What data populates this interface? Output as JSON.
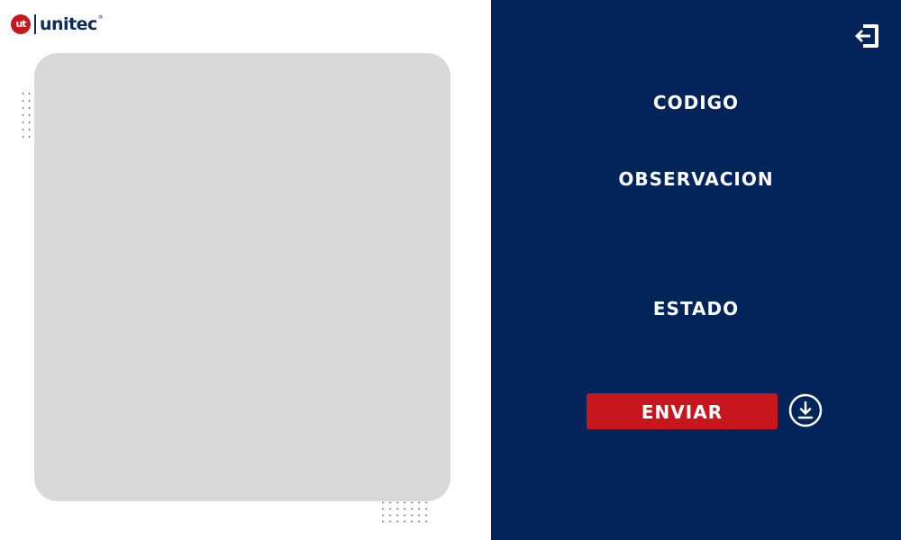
{
  "brand": {
    "logo_mark": "ut",
    "logo_text": "unitec",
    "registered": "®",
    "accent_color": "#c8161d",
    "navy_color": "#03245a"
  },
  "header": {
    "logout_icon": "logout-icon"
  },
  "form": {
    "codigo_label": "CODIGO",
    "observacion_label": "OBSERVACION",
    "estado_label": "ESTADO",
    "send_label": "ENVIAR",
    "download_icon": "download-icon"
  },
  "preview": {
    "placeholder_color": "#d9d9d9"
  }
}
